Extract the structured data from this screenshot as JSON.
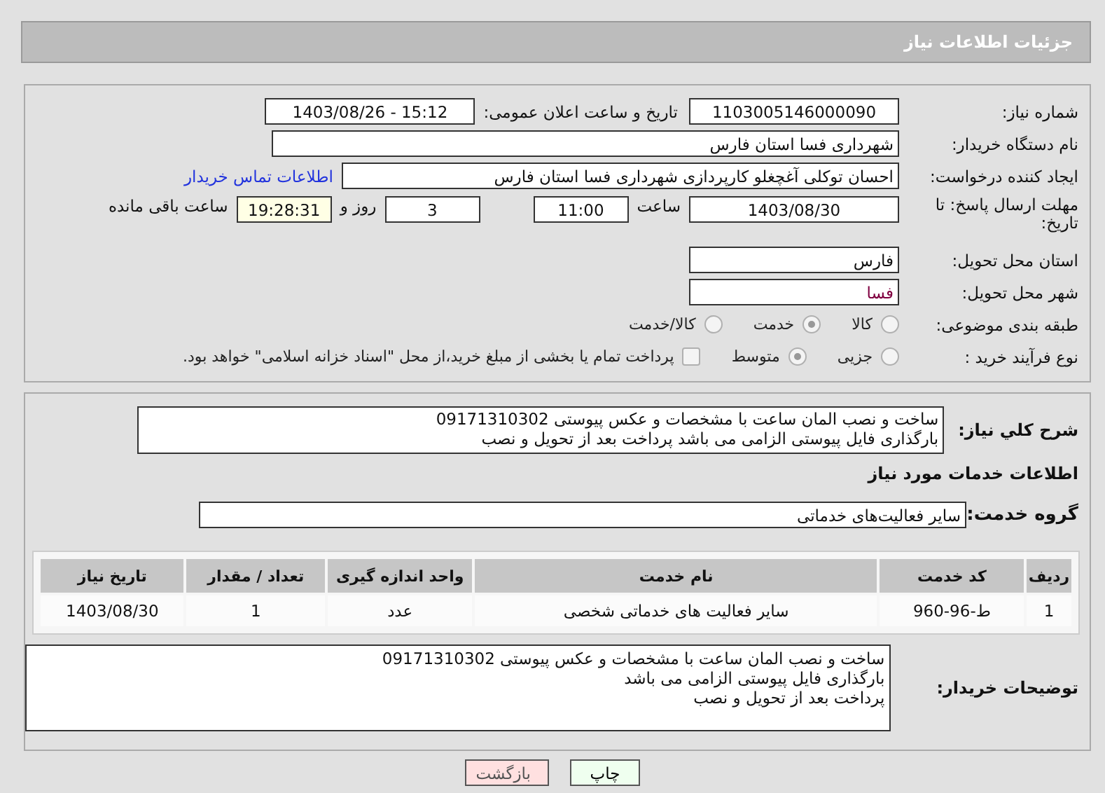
{
  "header": {
    "title": "جزئیات اطلاعات نیاز"
  },
  "details": {
    "need_number": {
      "label": "شماره نیاز:",
      "value": "1103005146000090"
    },
    "announce": {
      "label": "تاریخ و ساعت اعلان عمومی:",
      "value": "1403/08/26 - 15:12"
    },
    "buyer_org": {
      "label": "نام دستگاه خریدار:",
      "value": "شهرداری فسا استان فارس"
    },
    "requester": {
      "label": "ایجاد کننده درخواست:",
      "value": "احسان توکلی آغچغلو کارپردازی شهرداری فسا استان فارس",
      "link": "اطلاعات تماس خریدار"
    },
    "deadline": {
      "label": "مهلت ارسال پاسخ: تا تاریخ:",
      "date": "1403/08/30",
      "time_label": "ساعت",
      "time": "11:00",
      "days": "3",
      "days_label": "روز و",
      "remaining": "19:28:31",
      "remaining_label": "ساعت باقی مانده"
    },
    "province": {
      "label": "استان محل تحویل:",
      "value": "فارس"
    },
    "city": {
      "label": "شهر محل تحویل:",
      "value": "فسا"
    },
    "category": {
      "label": "طبقه بندی موضوعی:",
      "options": [
        {
          "label": "کالا",
          "selected": false
        },
        {
          "label": "خدمت",
          "selected": true
        },
        {
          "label": "کالا/خدمت",
          "selected": false
        }
      ]
    },
    "process": {
      "label": "نوع فرآیند خرید :",
      "options": [
        {
          "label": "جزیی",
          "selected": false
        },
        {
          "label": "متوسط",
          "selected": true
        }
      ],
      "payment": {
        "label": "پرداخت تمام یا بخشی از مبلغ خرید،از محل \"اسناد خزانه اسلامی\" خواهد بود.",
        "checked": false
      }
    }
  },
  "summary": {
    "label": "شرح کلي نياز:",
    "lines": [
      "ساخت و نصب المان ساعت با مشخصات و عکس پیوستی 09171310302",
      "بارگذاری فایل پیوستی الزامی می باشد پرداخت بعد از تحویل و نصب"
    ]
  },
  "services": {
    "heading": "اطلاعات خدمات مورد نیاز",
    "group_label": "گروه خدمت:",
    "group_value": "سایر فعالیت‌های خدماتی",
    "table": {
      "columns": [
        "ردیف",
        "کد خدمت",
        "نام خدمت",
        "واحد اندازه گیری",
        "تعداد / مقدار",
        "تاریخ نیاز"
      ],
      "rows": [
        [
          "1",
          "ط-96-960",
          "سایر فعالیت های خدماتی شخصی",
          "عدد",
          "1",
          "1403/08/30"
        ]
      ]
    }
  },
  "buyer_notes": {
    "label": "توضیحات خریدار:",
    "lines": [
      "ساخت و نصب المان ساعت با مشخصات و عکس پیوستی 09171310302",
      "بارگذاری فایل پیوستی الزامی می باشد",
      "پرداخت بعد از تحویل و نصب"
    ]
  },
  "buttons": [
    {
      "label": "چاپ",
      "kind": "print"
    },
    {
      "label": "بازگشت",
      "kind": "back"
    }
  ]
}
